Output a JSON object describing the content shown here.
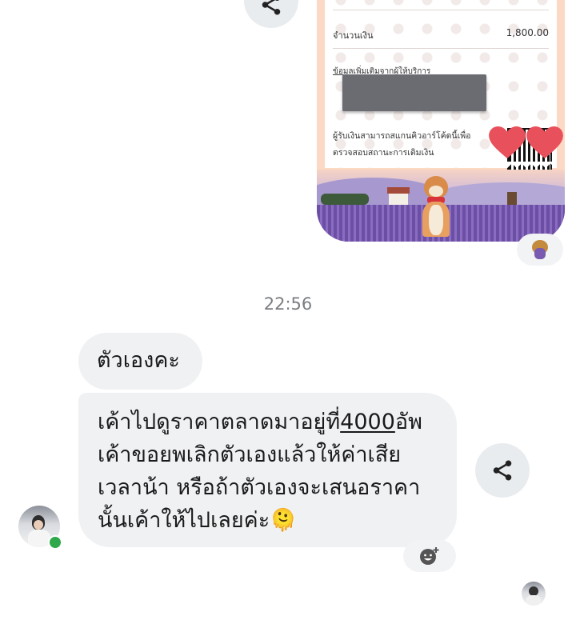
{
  "receipt": {
    "amount_label": "จำนวนเงิน",
    "amount_value": "1,800.00",
    "extra_info_label": "ข้อมูลเพิ่มเติมจากผู้ให้บริการ",
    "qr_note_line1": "ผู้รับเงินสามารถสแกนคิวอาร์โค้ดนี้เพื่อ",
    "qr_note_line2": "ตรวจสอบสถานะการเติมเงิน"
  },
  "timestamp": "22:56",
  "messages": [
    {
      "text": "ตัวเองคะ"
    },
    {
      "line1_before": "เค้าไปดูราคาตลาดมาอยู่ที่",
      "line1_underlined": "4000",
      "line1_after": "อัพ",
      "line2": "เค้าขอยพเลิกตัวเองแล้วให้ค่าเสีย",
      "line3": "เวลาน้า หรือถ้าตัวเองจะเสนอราคา",
      "line4": "นั้นเค้าให้ไปเลยค่ะ",
      "emoji": "🫠"
    }
  ],
  "icons": {
    "share": "share-icon",
    "add_reaction": "add-reaction-icon"
  },
  "colors": {
    "bubble": "#f0f1f3",
    "online": "#2ea84a",
    "share_bg": "#e9ecef"
  }
}
